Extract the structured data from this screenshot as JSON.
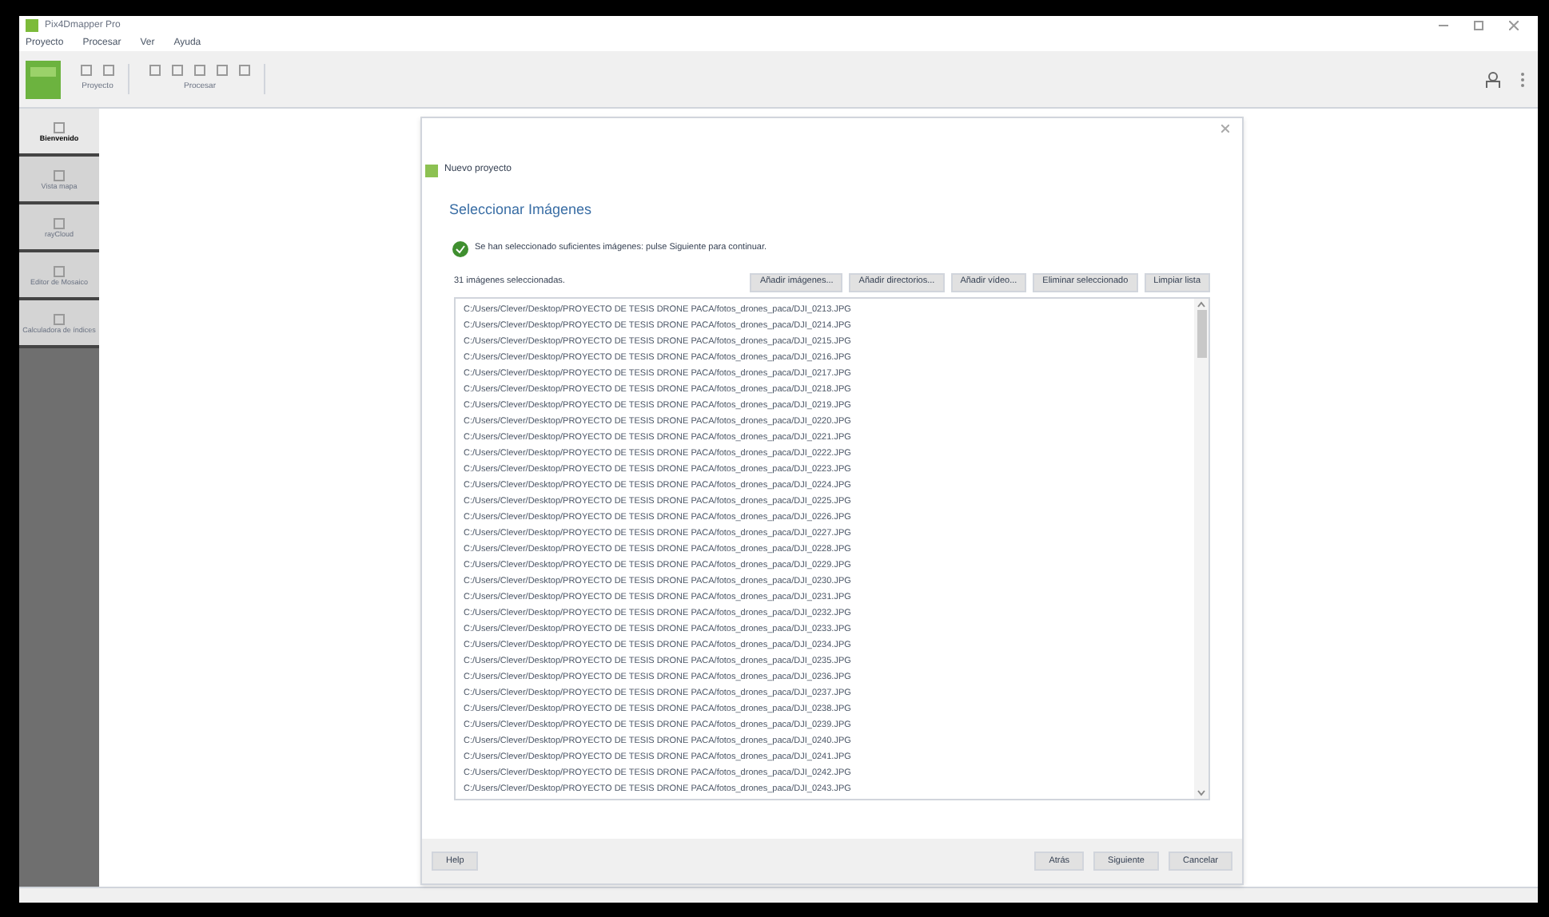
{
  "window": {
    "title": "Pix4Dmapper Pro"
  },
  "menu": [
    "Proyecto",
    "Procesar",
    "Ver",
    "Ayuda"
  ],
  "toolbar": {
    "groups": [
      {
        "label": "Proyecto"
      },
      {
        "label": "Procesar"
      }
    ]
  },
  "sidebar": {
    "items": [
      {
        "label": "Bienvenido",
        "selected": true
      },
      {
        "label": "Vista mapa",
        "selected": false
      },
      {
        "label": "rayCloud",
        "selected": false
      },
      {
        "label": "Editor de Mosaico",
        "selected": false
      },
      {
        "label": "Calculadora de índices",
        "selected": false
      }
    ]
  },
  "dialog": {
    "title": "Nuevo proyecto",
    "heading": "Seleccionar Imágenes",
    "message": "Se han seleccionado suficientes imágenes: pulse Siguiente para continuar.",
    "count": "31 imágenes seleccionadas.",
    "buttons": [
      "Añadir imágenes...",
      "Añadir directorios...",
      "Añadir vídeo...",
      "Eliminar seleccionado",
      "Limpiar lista"
    ],
    "files": [
      "C:/Users/Clever/Desktop/PROYECTO DE TESIS DRONE PACA/fotos_drones_paca/DJI_0213.JPG",
      "C:/Users/Clever/Desktop/PROYECTO DE TESIS DRONE PACA/fotos_drones_paca/DJI_0214.JPG",
      "C:/Users/Clever/Desktop/PROYECTO DE TESIS DRONE PACA/fotos_drones_paca/DJI_0215.JPG",
      "C:/Users/Clever/Desktop/PROYECTO DE TESIS DRONE PACA/fotos_drones_paca/DJI_0216.JPG",
      "C:/Users/Clever/Desktop/PROYECTO DE TESIS DRONE PACA/fotos_drones_paca/DJI_0217.JPG",
      "C:/Users/Clever/Desktop/PROYECTO DE TESIS DRONE PACA/fotos_drones_paca/DJI_0218.JPG",
      "C:/Users/Clever/Desktop/PROYECTO DE TESIS DRONE PACA/fotos_drones_paca/DJI_0219.JPG",
      "C:/Users/Clever/Desktop/PROYECTO DE TESIS DRONE PACA/fotos_drones_paca/DJI_0220.JPG",
      "C:/Users/Clever/Desktop/PROYECTO DE TESIS DRONE PACA/fotos_drones_paca/DJI_0221.JPG",
      "C:/Users/Clever/Desktop/PROYECTO DE TESIS DRONE PACA/fotos_drones_paca/DJI_0222.JPG",
      "C:/Users/Clever/Desktop/PROYECTO DE TESIS DRONE PACA/fotos_drones_paca/DJI_0223.JPG",
      "C:/Users/Clever/Desktop/PROYECTO DE TESIS DRONE PACA/fotos_drones_paca/DJI_0224.JPG",
      "C:/Users/Clever/Desktop/PROYECTO DE TESIS DRONE PACA/fotos_drones_paca/DJI_0225.JPG",
      "C:/Users/Clever/Desktop/PROYECTO DE TESIS DRONE PACA/fotos_drones_paca/DJI_0226.JPG",
      "C:/Users/Clever/Desktop/PROYECTO DE TESIS DRONE PACA/fotos_drones_paca/DJI_0227.JPG",
      "C:/Users/Clever/Desktop/PROYECTO DE TESIS DRONE PACA/fotos_drones_paca/DJI_0228.JPG",
      "C:/Users/Clever/Desktop/PROYECTO DE TESIS DRONE PACA/fotos_drones_paca/DJI_0229.JPG",
      "C:/Users/Clever/Desktop/PROYECTO DE TESIS DRONE PACA/fotos_drones_paca/DJI_0230.JPG",
      "C:/Users/Clever/Desktop/PROYECTO DE TESIS DRONE PACA/fotos_drones_paca/DJI_0231.JPG",
      "C:/Users/Clever/Desktop/PROYECTO DE TESIS DRONE PACA/fotos_drones_paca/DJI_0232.JPG",
      "C:/Users/Clever/Desktop/PROYECTO DE TESIS DRONE PACA/fotos_drones_paca/DJI_0233.JPG",
      "C:/Users/Clever/Desktop/PROYECTO DE TESIS DRONE PACA/fotos_drones_paca/DJI_0234.JPG",
      "C:/Users/Clever/Desktop/PROYECTO DE TESIS DRONE PACA/fotos_drones_paca/DJI_0235.JPG",
      "C:/Users/Clever/Desktop/PROYECTO DE TESIS DRONE PACA/fotos_drones_paca/DJI_0236.JPG",
      "C:/Users/Clever/Desktop/PROYECTO DE TESIS DRONE PACA/fotos_drones_paca/DJI_0237.JPG",
      "C:/Users/Clever/Desktop/PROYECTO DE TESIS DRONE PACA/fotos_drones_paca/DJI_0238.JPG",
      "C:/Users/Clever/Desktop/PROYECTO DE TESIS DRONE PACA/fotos_drones_paca/DJI_0239.JPG",
      "C:/Users/Clever/Desktop/PROYECTO DE TESIS DRONE PACA/fotos_drones_paca/DJI_0240.JPG",
      "C:/Users/Clever/Desktop/PROYECTO DE TESIS DRONE PACA/fotos_drones_paca/DJI_0241.JPG",
      "C:/Users/Clever/Desktop/PROYECTO DE TESIS DRONE PACA/fotos_drones_paca/DJI_0242.JPG",
      "C:/Users/Clever/Desktop/PROYECTO DE TESIS DRONE PACA/fotos_drones_paca/DJI_0243.JPG"
    ],
    "footer": {
      "help": "Help",
      "buttons": [
        "Atrás",
        "Siguiente",
        "Cancelar"
      ]
    }
  }
}
